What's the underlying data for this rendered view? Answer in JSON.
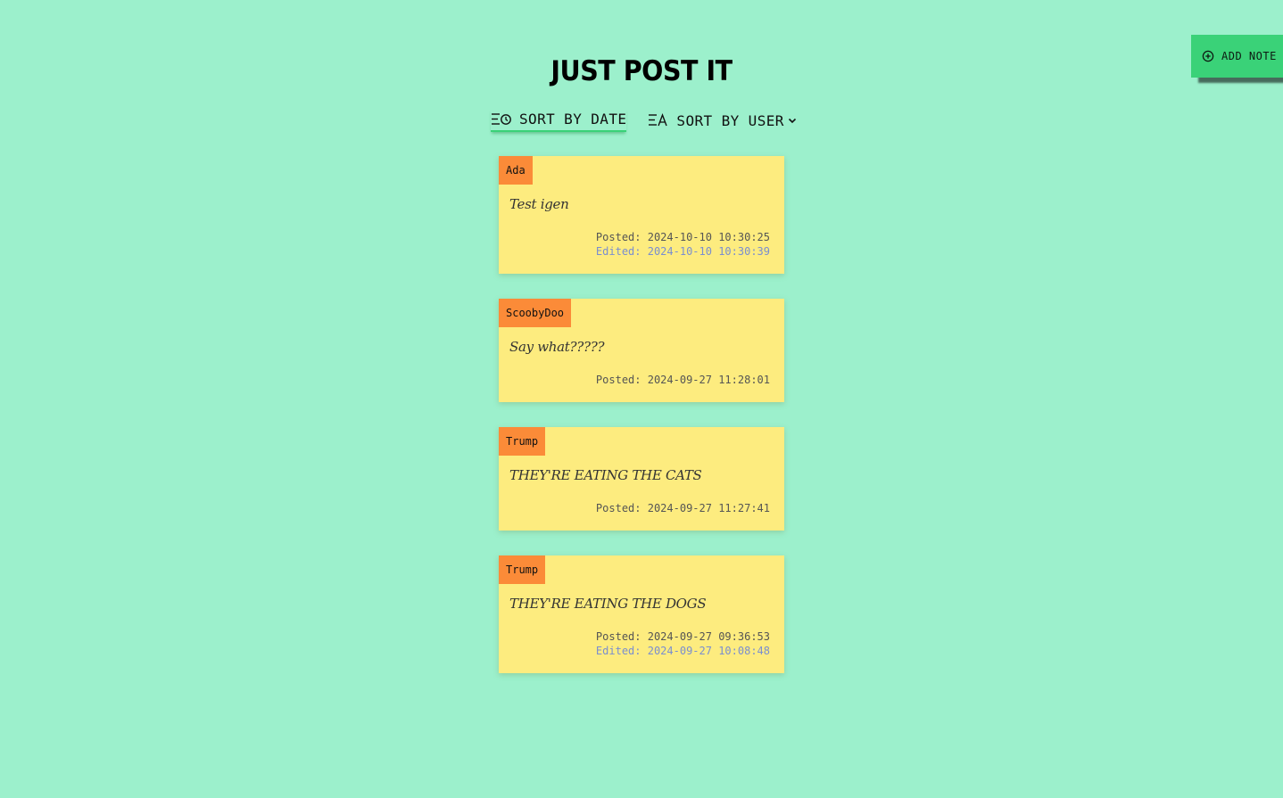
{
  "header": {
    "title": "JUST POST IT",
    "add_note_label": "ADD NOTE",
    "add_note_icon": "plus-circle-icon"
  },
  "sort": {
    "by_date_label": "SORT BY DATE",
    "by_date_icon": "sort-clock-icon",
    "by_user_label": "SORT BY USER",
    "by_user_icon": "sort-alpha-icon",
    "active": "date"
  },
  "colors": {
    "background": "#9cf0cc",
    "note": "#fdec7f",
    "user_tag": "#fb8b38",
    "accent": "#3ad278",
    "edited_text": "#7a8ed0"
  },
  "notes": [
    {
      "user": "Ada",
      "text": "Test igen",
      "posted": "Posted: 2024-10-10 10:30:25",
      "edited": "Edited: 2024-10-10 10:30:39"
    },
    {
      "user": "ScoobyDoo",
      "text": "Say what?????",
      "posted": "Posted: 2024-09-27 11:28:01",
      "edited": ""
    },
    {
      "user": "Trump",
      "text": "THEY'RE EATING THE CATS",
      "posted": "Posted: 2024-09-27 11:27:41",
      "edited": ""
    },
    {
      "user": "Trump",
      "text": "THEY'RE EATING THE DOGS",
      "posted": "Posted: 2024-09-27 09:36:53",
      "edited": "Edited: 2024-09-27 10:08:48"
    }
  ]
}
